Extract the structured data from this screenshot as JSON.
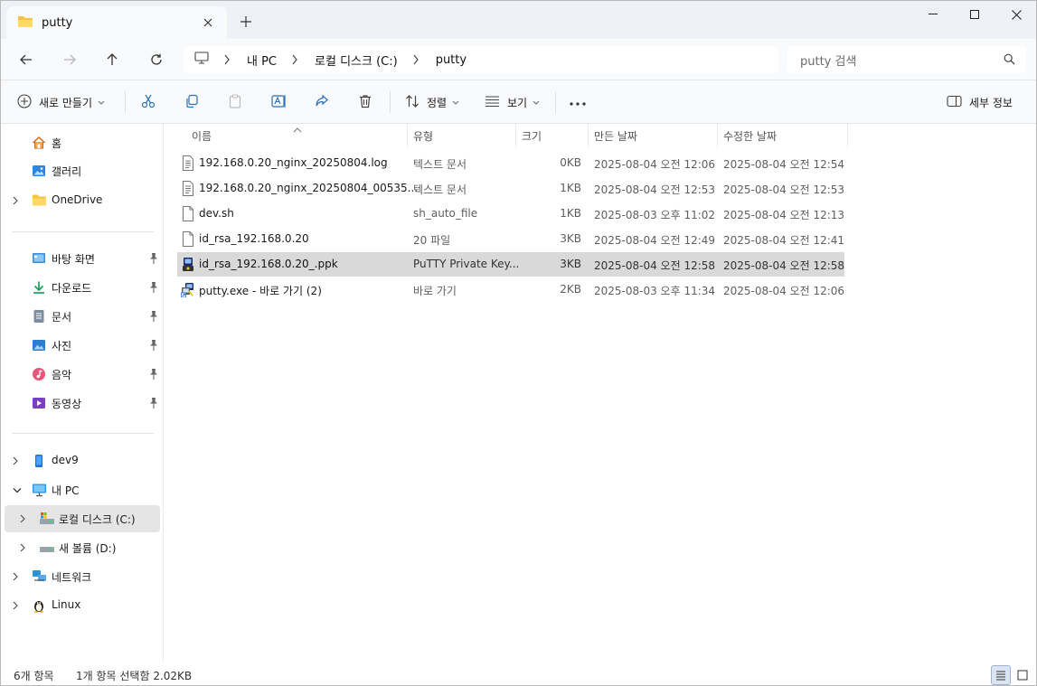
{
  "window": {
    "tab_title": "putty"
  },
  "navigation": {
    "breadcrumbs": [
      "내 PC",
      "로컬 디스크 (C:)",
      "putty"
    ],
    "search_placeholder": "putty 검색"
  },
  "commands": {
    "new": "새로 만들기",
    "sort": "정렬",
    "view": "보기",
    "details": "세부 정보"
  },
  "sidebar": {
    "top_items": [
      {
        "label": "홈",
        "icon": "home-icon"
      },
      {
        "label": "갤러리",
        "icon": "gallery-icon"
      },
      {
        "label": "OneDrive",
        "icon": "folder-icon"
      }
    ],
    "quick_access": [
      {
        "label": "바탕 화면",
        "icon": "desktop-icon"
      },
      {
        "label": "다운로드",
        "icon": "download-icon"
      },
      {
        "label": "문서",
        "icon": "document-icon"
      },
      {
        "label": "사진",
        "icon": "picture-icon"
      },
      {
        "label": "음악",
        "icon": "music-icon"
      },
      {
        "label": "동영상",
        "icon": "video-icon"
      }
    ],
    "devices": [
      {
        "label": "dev9",
        "icon": "phone-icon"
      },
      {
        "label": "내 PC",
        "icon": "pc-icon"
      },
      {
        "label": "로컬 디스크 (C:)",
        "icon": "drive-icon"
      },
      {
        "label": "새 볼륨 (D:)",
        "icon": "drive-icon"
      },
      {
        "label": "네트워크",
        "icon": "network-icon"
      },
      {
        "label": "Linux",
        "icon": "linux-icon"
      }
    ]
  },
  "columns": {
    "name": "이름",
    "type": "유형",
    "size": "크기",
    "created": "만든 날짜",
    "modified": "수정한 날짜"
  },
  "files": [
    {
      "name": "192.168.0.20_nginx_20250804.log",
      "type": "텍스트 문서",
      "size": "0KB",
      "created": "2025-08-04 오전 12:06",
      "modified": "2025-08-04 오전 12:54",
      "icon": "text-file-icon"
    },
    {
      "name": "192.168.0.20_nginx_20250804_00535...",
      "type": "텍스트 문서",
      "size": "1KB",
      "created": "2025-08-04 오전 12:53",
      "modified": "2025-08-04 오전 12:53",
      "icon": "text-file-icon"
    },
    {
      "name": "dev.sh",
      "type": "sh_auto_file",
      "size": "1KB",
      "created": "2025-08-03 오후 11:02",
      "modified": "2025-08-04 오전 12:13",
      "icon": "blank-file-icon"
    },
    {
      "name": "id_rsa_192.168.0.20",
      "type": "20 파일",
      "size": "3KB",
      "created": "2025-08-04 오전 12:49",
      "modified": "2025-08-04 오전 12:41",
      "icon": "blank-file-icon"
    },
    {
      "name": "id_rsa_192.168.0.20_.ppk",
      "type": "PuTTY Private Key...",
      "size": "3KB",
      "created": "2025-08-04 오전 12:58",
      "modified": "2025-08-04 오전 12:58",
      "icon": "putty-key-icon"
    },
    {
      "name": "putty.exe - 바로 가기 (2)",
      "type": "바로 가기",
      "size": "2KB",
      "created": "2025-08-03 오후 11:34",
      "modified": "2025-08-04 오전 12:06",
      "icon": "putty-shortcut-icon"
    }
  ],
  "status": {
    "count": "6개 항목",
    "selection": "1개 항목 선택함 2.02KB"
  },
  "colors": {
    "accent": "#0067c0",
    "folder": "#f5c445",
    "selected_row": "#d9d9d9"
  }
}
